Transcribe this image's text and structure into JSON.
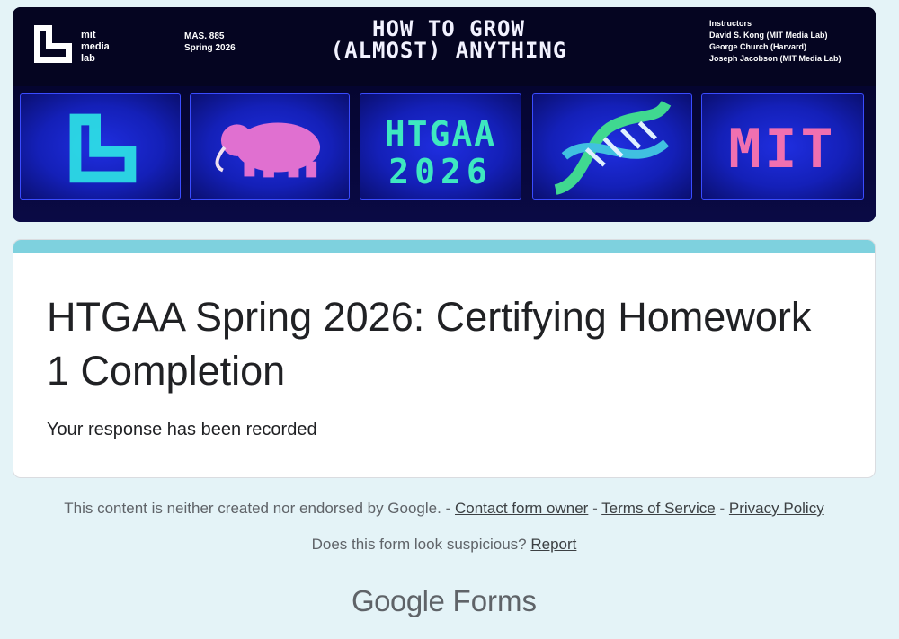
{
  "banner": {
    "logo_lines": [
      "mit",
      "media",
      "lab"
    ],
    "course_code": "MAS. 885",
    "term": "Spring 2026",
    "title_lines": [
      "HOW TO GROW",
      "(ALMOST) ANYTHING"
    ],
    "instructors_heading": "Instructors",
    "instructors": [
      "David S. Kong (MIT Media Lab)",
      "George Church (Harvard)",
      "Joseph Jacobson (MIT Media Lab)"
    ],
    "panel_htgaa": "HTGAA",
    "panel_year": "2026",
    "panel_mit": "MIT"
  },
  "form": {
    "title": "HTGAA Spring 2026: Certifying Homework 1 Completion",
    "confirmation": "Your response has been recorded"
  },
  "footer": {
    "disclaimer": "This content is neither created nor endorsed by Google.",
    "sep": "-",
    "contact": "Contact form owner",
    "terms": "Terms of Service",
    "privacy": "Privacy Policy",
    "suspicious_q": "Does this form look suspicious?",
    "report": "Report",
    "brand_google": "Google",
    "brand_forms": "Forms"
  },
  "colors": {
    "background": "#e4f3f7",
    "accent": "#7ed1de",
    "banner_bg": "#050521"
  }
}
